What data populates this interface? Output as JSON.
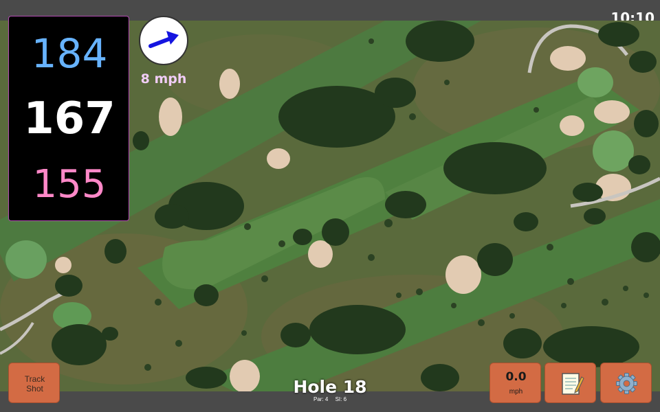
{
  "status": {
    "time": "10:10"
  },
  "distances": {
    "back": "184",
    "middle": "167",
    "front": "155"
  },
  "wind": {
    "speed": "8 mph",
    "arrow_icon": "wind-direction-arrow-icon"
  },
  "hole": {
    "title": "Hole 18",
    "par": "Par: 4",
    "stroke_index": "SI: 6"
  },
  "buttons": {
    "track_shot": "Track\nShot",
    "speed_value": "0.0",
    "speed_unit": "mph",
    "notes_icon": "notepad-icon",
    "settings_icon": "gear-icon"
  },
  "colors": {
    "back_distance": "#67b3ff",
    "middle_distance": "#ffffff",
    "front_distance": "#ff88c8",
    "button": "#d36b44",
    "panel_border": "#b34cb3"
  }
}
